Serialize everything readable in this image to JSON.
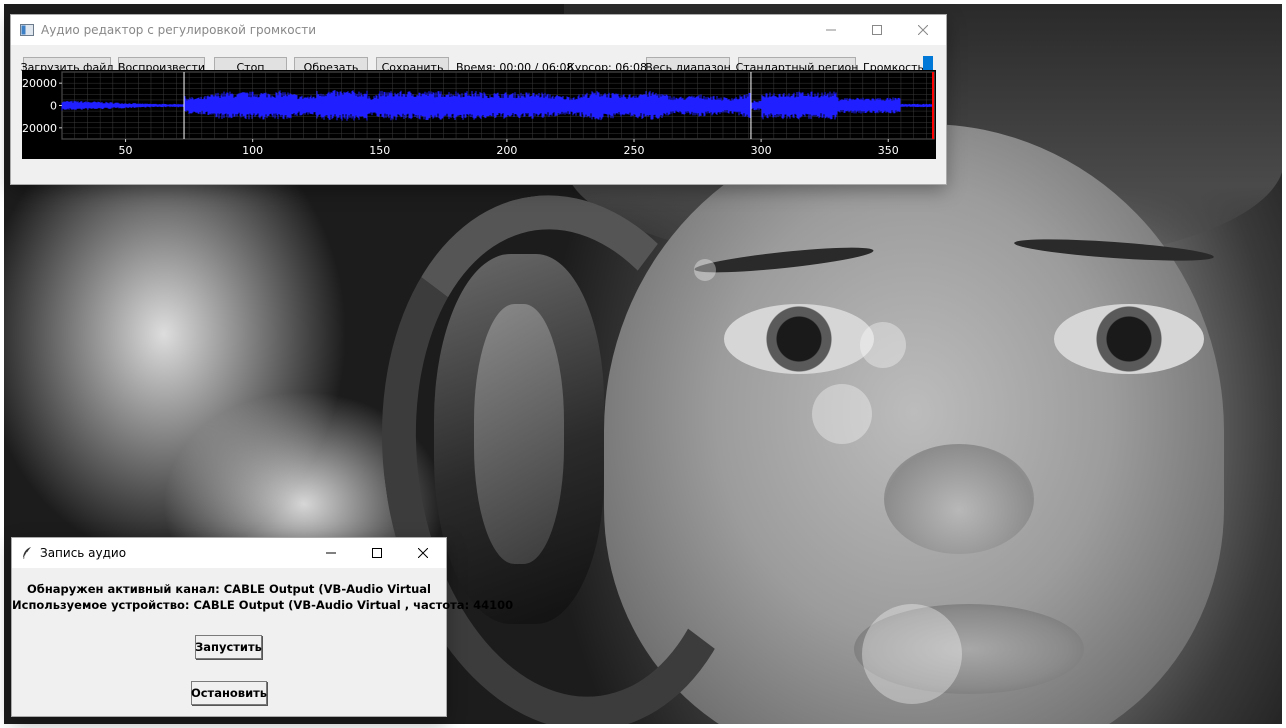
{
  "editor": {
    "title": "Аудио редактор с регулировкой громкости",
    "toolbar": {
      "load_label": "Загрузить файл",
      "play_label": "Воспроизвести",
      "stop_label": "Стоп",
      "trim_label": "Обрезать",
      "save_label": "Сохранить",
      "time_text": "Время: 00:00 / 06:08",
      "cursor_text": "Курсор: 06:08",
      "full_range_label": "Весь диапазон",
      "standard_region_label": "Стандартный регион",
      "volume_label": "Громкость"
    },
    "waveform": {
      "y_ticks": [
        "20000",
        "0",
        "-20000"
      ],
      "x_ticks": [
        "50",
        "100",
        "150",
        "200",
        "250",
        "300",
        "350"
      ],
      "y_tick_values": [
        20000,
        0,
        -20000
      ],
      "x_tick_values": [
        50,
        100,
        150,
        200,
        250,
        300,
        350
      ],
      "x_range": [
        25,
        368
      ],
      "y_range": [
        -30000,
        30000
      ],
      "region_start": 73,
      "region_end": 296,
      "cursor_pos": 368,
      "wave_color": "#1f1fff",
      "grid_color": "#3a3a3a",
      "marker_color": "#ffffff",
      "cursor_color": "#ff0000"
    },
    "volume_accent": "#0078d7"
  },
  "recorder": {
    "title": "Запись аудио",
    "channel_text": "Обнаружен активный канал: CABLE Output (VB-Audio Virtual",
    "device_text": "Используемое устройство: CABLE Output (VB-Audio Virtual , частота: 44100",
    "start_label": "Запустить",
    "stop_label": "Остановить"
  }
}
